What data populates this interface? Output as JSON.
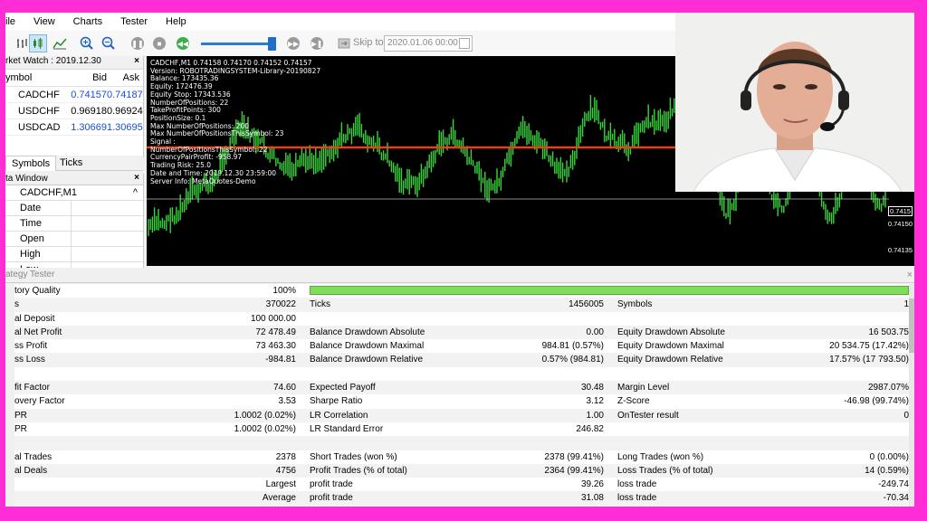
{
  "menu": [
    "ile",
    "View",
    "Charts",
    "Tester",
    "Help"
  ],
  "toolbar": {
    "skip_to_label": "Skip to",
    "skip_date": "2020.01.06 00:00",
    "speed_percent": 95
  },
  "market_watch": {
    "title": "rket Watch : 2019.12.30",
    "col_symbol": "ymbol",
    "col_bid": "Bid",
    "col_ask": "Ask",
    "rows": [
      {
        "symbol": "CADCHF",
        "bid": "0.74157",
        "ask": "0.74187",
        "blue": true
      },
      {
        "symbol": "USDCHF",
        "bid": "0.96918",
        "ask": "0.96924",
        "blue": false
      },
      {
        "symbol": "USDCAD",
        "bid": "1.30669",
        "ask": "1.30695",
        "blue": true
      }
    ]
  },
  "tabs": {
    "symbols": "Symbols",
    "ticks": "Ticks"
  },
  "data_window": {
    "title": "ta Window",
    "symbol": "CADCHF,M1",
    "rows": [
      "Date",
      "Time",
      "Open",
      "High",
      "Low"
    ]
  },
  "chart": {
    "lines": [
      "CADCHF,M1  0.74158 0.74170 0.74152 0.74157",
      "Version: ROBOTRADINGSYSTEM-Library-20190827",
      "Balance: 173435.36",
      "Equity: 172476.39",
      "Equity Stop: 17343.536",
      "NumberOfPositions: 22",
      "TakeProfitPoints: 300",
      "PositionSize: 0.1",
      "Max NumberOfPositions: 200",
      "Max NumberOfPositionsThisSymbol: 23",
      "Signal :",
      "NumberOfPositionsThisSymbol: 22",
      "CurrencyPairProfit: -958.97",
      "Trading Risk: 25.0",
      "Date and Time: 2019.12.30 23:59:00",
      "Server Info: MetaQuotes-Demo"
    ],
    "price_labels": [
      "0.7415",
      "0.74150",
      "0.74135"
    ]
  },
  "tester": {
    "title": "ategy Tester",
    "quality_label": "tory Quality",
    "quality_value": "100%",
    "quality_fraction": 1.0,
    "rows": [
      {
        "k1": "s",
        "v1": "370022",
        "k2": "Ticks",
        "v2": "1456005",
        "k3": "Symbols",
        "v3": "1"
      },
      {
        "k1": "al Deposit",
        "v1": "100 000.00",
        "k2": "",
        "v2": "",
        "k3": "",
        "v3": ""
      },
      {
        "k1": "al Net Profit",
        "v1": "72 478.49",
        "k2": "Balance Drawdown Absolute",
        "v2": "0.00",
        "k3": "Equity Drawdown Absolute",
        "v3": "16 503.75"
      },
      {
        "k1": "ss Profit",
        "v1": "73 463.30",
        "k2": "Balance Drawdown Maximal",
        "v2": "984.81 (0.57%)",
        "k3": "Equity Drawdown Maximal",
        "v3": "20 534.75 (17.42%)"
      },
      {
        "k1": "ss Loss",
        "v1": "-984.81",
        "k2": "Balance Drawdown Relative",
        "v2": "0.57% (984.81)",
        "k3": "Equity Drawdown Relative",
        "v3": "17.57% (17 793.50)"
      },
      {
        "k1": "",
        "v1": "",
        "k2": "",
        "v2": "",
        "k3": "",
        "v3": ""
      },
      {
        "k1": "fit Factor",
        "v1": "74.60",
        "k2": "Expected Payoff",
        "v2": "30.48",
        "k3": "Margin Level",
        "v3": "2987.07%"
      },
      {
        "k1": "overy Factor",
        "v1": "3.53",
        "k2": "Sharpe Ratio",
        "v2": "3.12",
        "k3": "Z-Score",
        "v3": "-46.98 (99.74%)"
      },
      {
        "k1": "PR",
        "v1": "1.0002 (0.02%)",
        "k2": "LR Correlation",
        "v2": "1.00",
        "k3": "OnTester result",
        "v3": "0"
      },
      {
        "k1": "PR",
        "v1": "1.0002 (0.02%)",
        "k2": "LR Standard Error",
        "v2": "246.82",
        "k3": "",
        "v3": ""
      },
      {
        "k1": "",
        "v1": "",
        "k2": "",
        "v2": "",
        "k3": "",
        "v3": ""
      },
      {
        "k1": "al Trades",
        "v1": "2378",
        "k2": "Short Trades (won %)",
        "v2": "2378 (99.41%)",
        "k3": "Long Trades (won %)",
        "v3": "0 (0.00%)"
      },
      {
        "k1": "al Deals",
        "v1": "4756",
        "k2": "Profit Trades (% of total)",
        "v2": "2364 (99.41%)",
        "k3": "Loss Trades (% of total)",
        "v3": "14 (0.59%)"
      },
      {
        "k1": "",
        "v1": "Largest",
        "k2": "profit trade",
        "v2": "39.26",
        "k3": "loss trade",
        "v3": "-249.74"
      },
      {
        "k1": "",
        "v1": "Average",
        "k2": "profit trade",
        "v2": "31.08",
        "k3": "loss trade",
        "v3": "-70.34"
      }
    ]
  }
}
